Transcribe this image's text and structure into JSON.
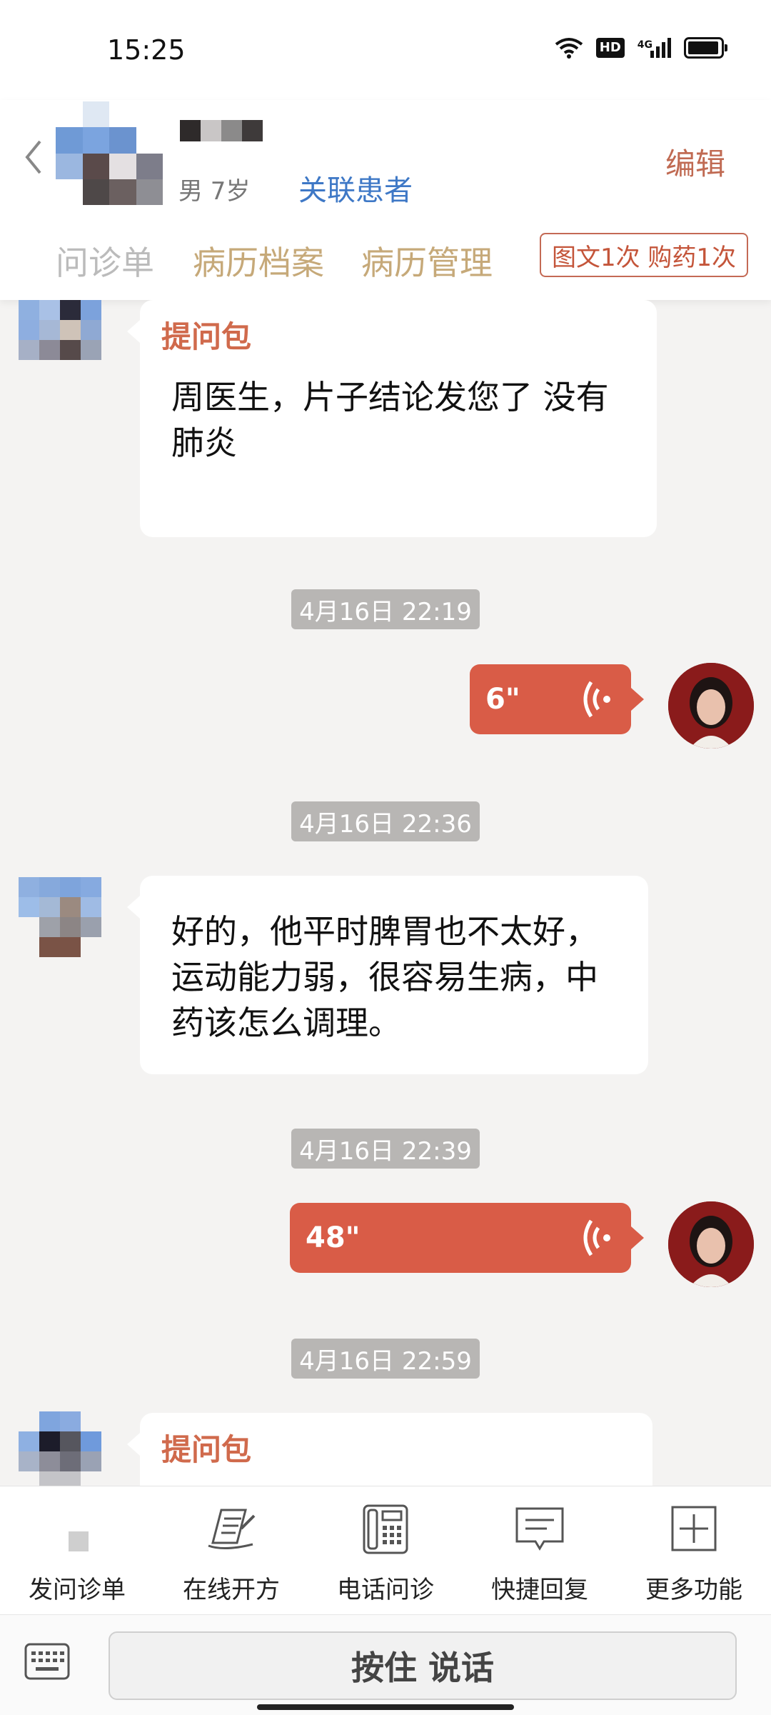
{
  "status_bar": {
    "time": "15:25",
    "hd": "HD",
    "network": "4G",
    "icons": [
      "wifi-icon",
      "hd-icon",
      "signal-4g-icon",
      "battery-icon"
    ]
  },
  "header": {
    "patient_info": "男 7岁",
    "link_patient": "关联患者",
    "edit": "编辑",
    "tabs": [
      {
        "label": "问诊单"
      },
      {
        "label": "病历档案"
      },
      {
        "label": "病历管理"
      }
    ],
    "service_badge": "图文1次 购药1次"
  },
  "chat": {
    "messages": [
      {
        "type": "question-pack",
        "label": "提问包",
        "text": "周医生，片子结论发您了 没有肺炎"
      },
      {
        "type": "timestamp",
        "text": "4月16日 22:19"
      },
      {
        "type": "voice-out",
        "duration": "6\""
      },
      {
        "type": "timestamp",
        "text": "4月16日 22:36"
      },
      {
        "type": "text-in",
        "text": "好的，他平时脾胃也不太好，运动能力弱，很容易生病，中药该怎么调理。"
      },
      {
        "type": "timestamp",
        "text": "4月16日 22:39"
      },
      {
        "type": "voice-out",
        "duration": "48\""
      },
      {
        "type": "timestamp",
        "text": "4月16日 22:59"
      },
      {
        "type": "question-pack",
        "label": "提问包"
      }
    ]
  },
  "toolbar": {
    "items": [
      {
        "label": "发问诊单",
        "icon": "questionnaire-icon"
      },
      {
        "label": "在线开方",
        "icon": "prescription-icon"
      },
      {
        "label": "电话问诊",
        "icon": "phone-icon"
      },
      {
        "label": "快捷回复",
        "icon": "quick-reply-icon"
      },
      {
        "label": "更多功能",
        "icon": "plus-icon"
      }
    ]
  },
  "input_bar": {
    "talk_button": "按住 说话",
    "keyboard_icon": "keyboard-icon"
  },
  "colors": {
    "accent": "#d95c47",
    "tab_gold": "#c6a979",
    "link_blue": "#3e78c6",
    "background": "#f4f3f2"
  }
}
